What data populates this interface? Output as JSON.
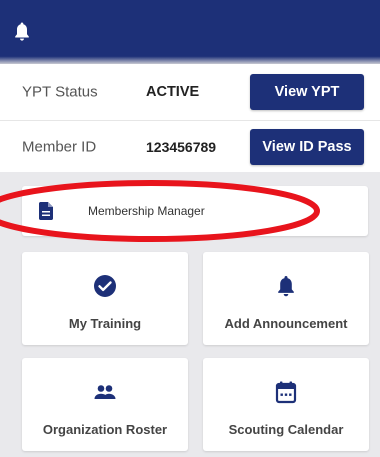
{
  "header": {
    "icon": "bell-icon",
    "background": "#1d3078"
  },
  "status_rows": [
    {
      "label": "YPT Status",
      "value": "ACTIVE",
      "button_label": "View YPT"
    },
    {
      "label": "Member ID",
      "value": "123456789",
      "button_label": "View ID Pass"
    }
  ],
  "membership_manager": {
    "icon": "document-icon",
    "label": "Membership Manager"
  },
  "tiles": [
    {
      "icon": "check-circle-icon",
      "label": "My Training"
    },
    {
      "icon": "bell-icon",
      "label": "Add Announcement"
    },
    {
      "icon": "people-icon",
      "label": "Organization Roster"
    },
    {
      "icon": "calendar-icon",
      "label": "Scouting Calendar"
    }
  ],
  "colors": {
    "primary": "#1d3078",
    "annotation": "#e8141c",
    "background": "#e9e9ec"
  }
}
